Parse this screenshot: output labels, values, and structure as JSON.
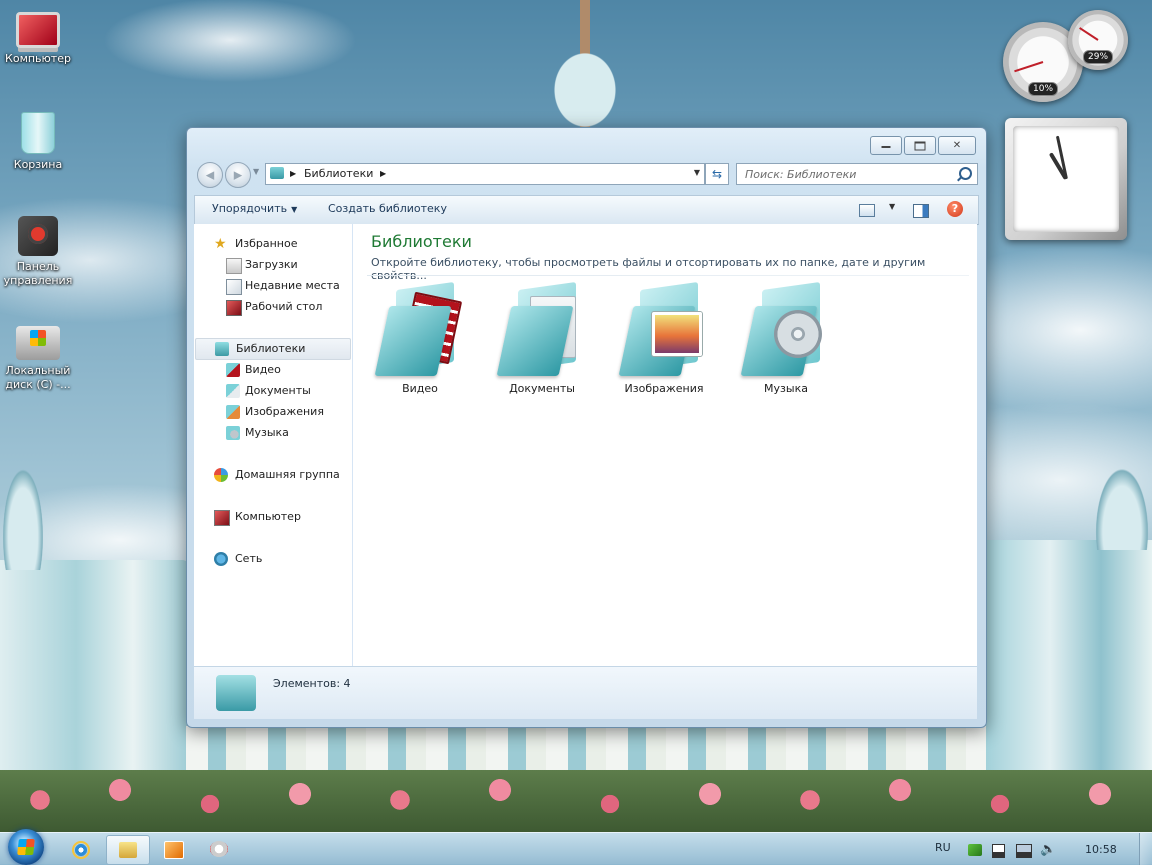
{
  "desktop": {
    "icons": [
      {
        "label": "Компьютер"
      },
      {
        "label": "Корзина"
      },
      {
        "label": "Панель управления"
      },
      {
        "label": "Локальный диск (C) -..."
      }
    ]
  },
  "gadgets": {
    "cpu_percent": "10%",
    "memory_percent": "29%",
    "cpu_level": 0.1,
    "memory_level": 0.29,
    "clock_hour": 10,
    "clock_minute": 58
  },
  "window": {
    "address": {
      "crumb": "Библиотеки",
      "search_placeholder": "Поиск: Библиотеки"
    },
    "toolbar": {
      "organize": "Упорядочить",
      "create_library": "Создать библиотеку"
    },
    "nav": {
      "favorites": "Избранное",
      "downloads": "Загрузки",
      "recent": "Недавние места",
      "desktop": "Рабочий стол",
      "libraries": "Библиотеки",
      "video": "Видео",
      "documents": "Документы",
      "images": "Изображения",
      "music": "Музыка",
      "homegroup": "Домашняя группа",
      "computer": "Компьютер",
      "network": "Сеть"
    },
    "content": {
      "title": "Библиотеки",
      "subtitle": "Откройте библиотеку, чтобы просмотреть файлы и отсортировать их по папке, дате и другим свойств...",
      "libraries": [
        {
          "label": "Видео"
        },
        {
          "label": "Документы"
        },
        {
          "label": "Изображения"
        },
        {
          "label": "Музыка"
        }
      ]
    },
    "status": {
      "items": "Элементов: 4"
    }
  },
  "taskbar": {
    "language": "RU",
    "time": "10:58"
  },
  "colors": {
    "accent_title": "#1f7a34",
    "link_text": "#1e3a5a"
  }
}
